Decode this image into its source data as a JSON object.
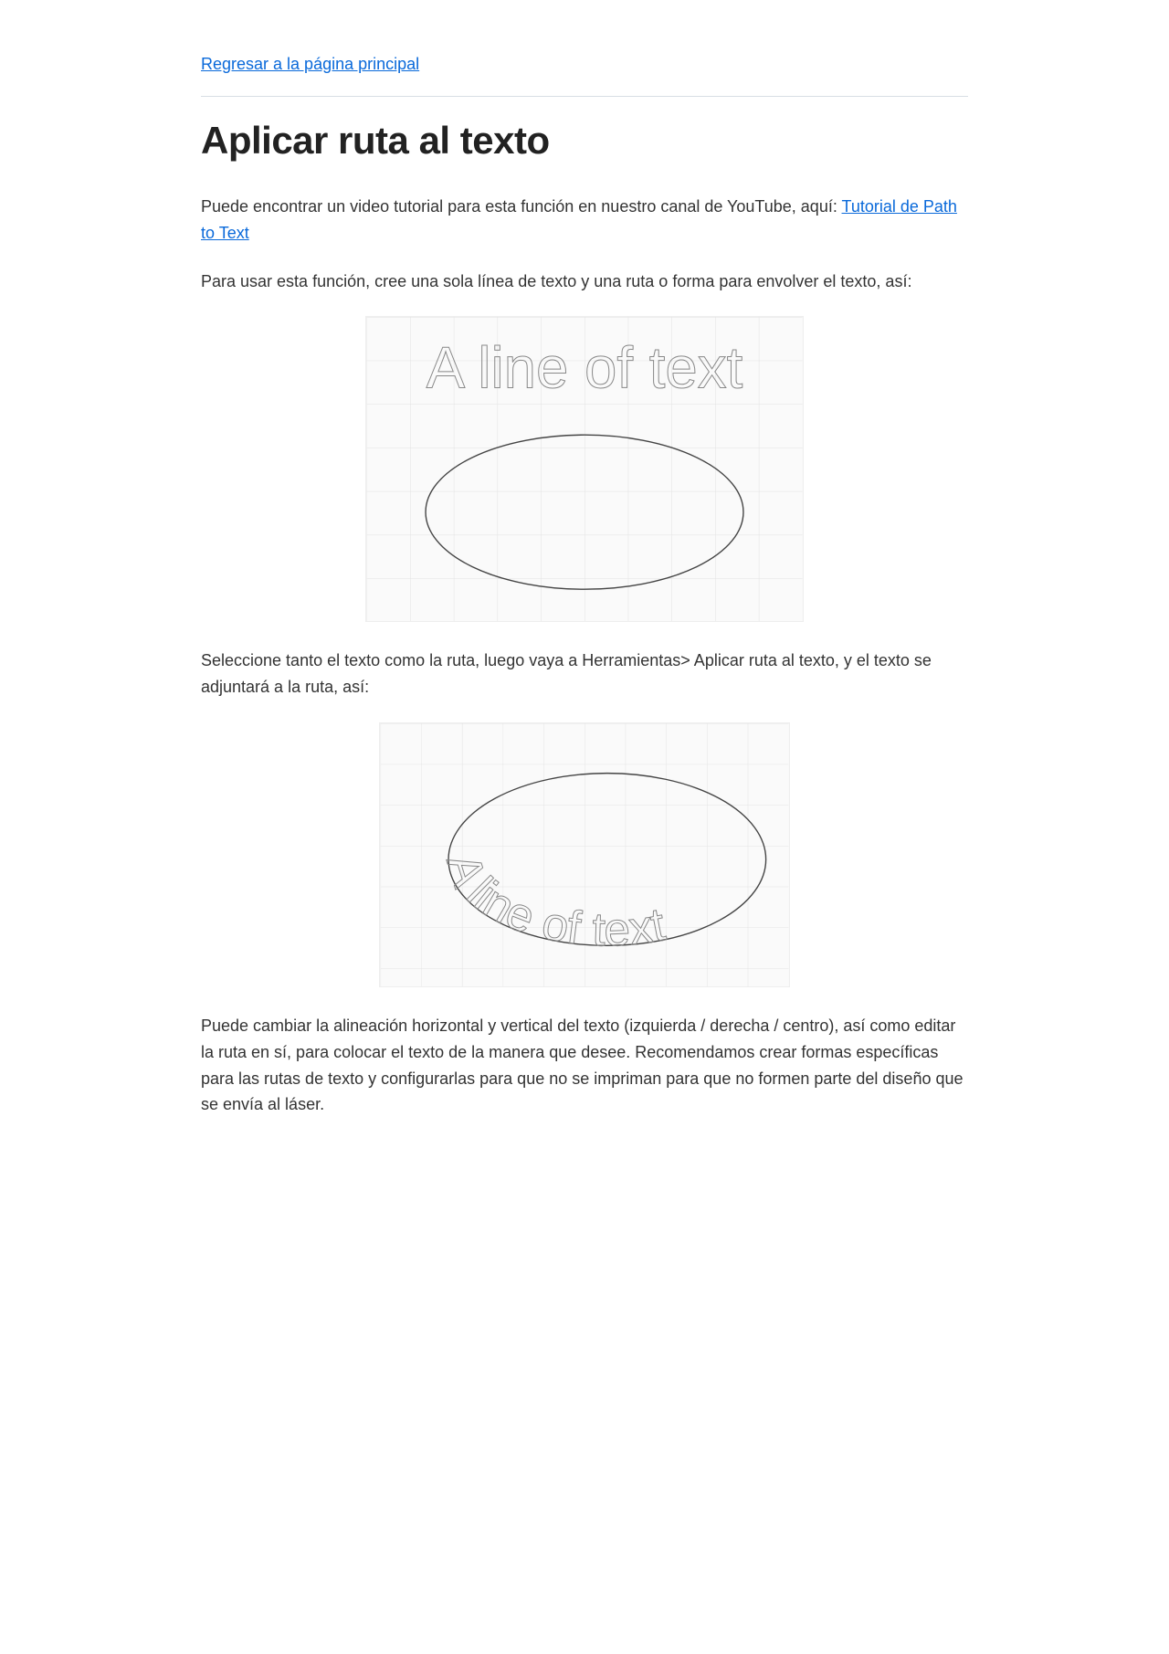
{
  "nav": {
    "back_label": "Regresar a la página principal"
  },
  "page": {
    "title": "Aplicar ruta al texto"
  },
  "intro": {
    "part1": "Puede encontrar un video tutorial para esta función en nuestro canal de YouTube, aquí: ",
    "link_label": "Tutorial de Path to Text"
  },
  "para2": "Para usar esta función, cree una sola línea de texto y una ruta o forma para envolver el texto, así:",
  "fig1": {
    "outline_text": "A line of text"
  },
  "para3": "Seleccione tanto el texto como la ruta, luego vaya a Herramientas> Aplicar ruta al texto, y el texto se adjuntará a la ruta, así:",
  "para4": "Puede cambiar la alineación horizontal y vertical del texto (izquierda / derecha / centro), así como editar la ruta en sí, para colocar el texto de la manera que desee. Recomendamos crear formas específicas para las rutas de texto y configurarlas para que no se impriman para que no formen parte del diseño que se envía al láser."
}
